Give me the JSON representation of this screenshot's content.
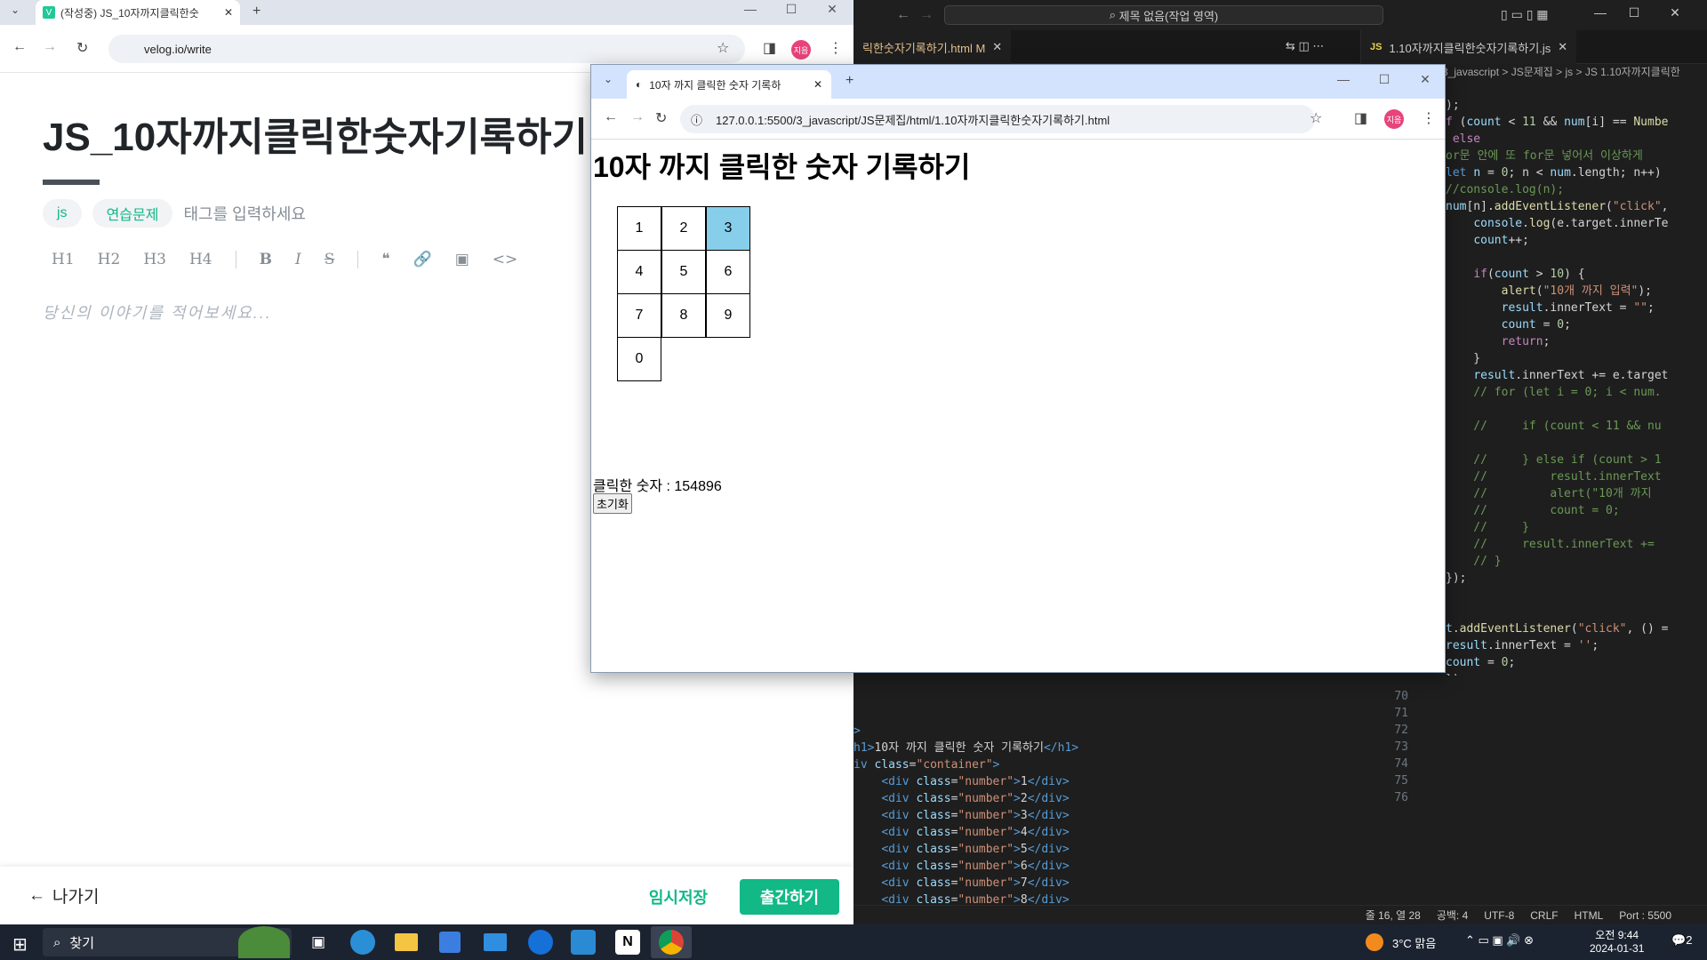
{
  "velog": {
    "tab_title": "(작성중) JS_10자까지클릭한숫",
    "url": "velog.io/write",
    "post_title": "JS_10자까지클릭한숫자기록하기",
    "tags": [
      "js",
      "연습문제"
    ],
    "tag_placeholder": "태그를 입력하세요",
    "toolbar": [
      "H1",
      "H2",
      "H3",
      "H4",
      "B",
      "I",
      "S",
      "❝",
      "🔗",
      "▣",
      "<>"
    ],
    "body_placeholder": "당신의 이야기를 적어보세요...",
    "exit_label": "나가기",
    "save_label": "임시저장",
    "publish_label": "출간하기",
    "avatar_label": "지음"
  },
  "vscode": {
    "search_placeholder": "제목 없음(작업 영역)",
    "tab_html": "릭한숫자기록하기.html M",
    "tab_js": "1.10자까지클릭한숫자기록하기.js",
    "breadcrumb": "3_javascript > JS문제집 > js > JS 1.10자까지클릭한",
    "status": {
      "position": "줄 16, 열 28",
      "spaces": "공백: 4",
      "encoding": "UTF-8",
      "eol": "CRLF",
      "language": "HTML",
      "port": "Port : 5500"
    }
  },
  "popup": {
    "tab_title": "10자 까지 클릭한 숫자 기록하",
    "url": "127.0.0.1:5500/3_javascript/JS문제집/html/1.10자까지클릭한숫자기록하기.html",
    "heading": "10자 까지 클릭한 숫자 기록하기",
    "numbers": [
      "1",
      "2",
      "3",
      "4",
      "5",
      "6",
      "7",
      "8",
      "9",
      "0"
    ],
    "active_number": "3",
    "result_label": "클릭한 숫자 : 154896",
    "reset_label": "초기화",
    "active_color": "#87ceeb"
  },
  "taskbar": {
    "search_label": "찾기",
    "weather": "3°C 맑음",
    "time": "오전 9:44",
    "date": "2024-01-31",
    "notifications": "2"
  }
}
